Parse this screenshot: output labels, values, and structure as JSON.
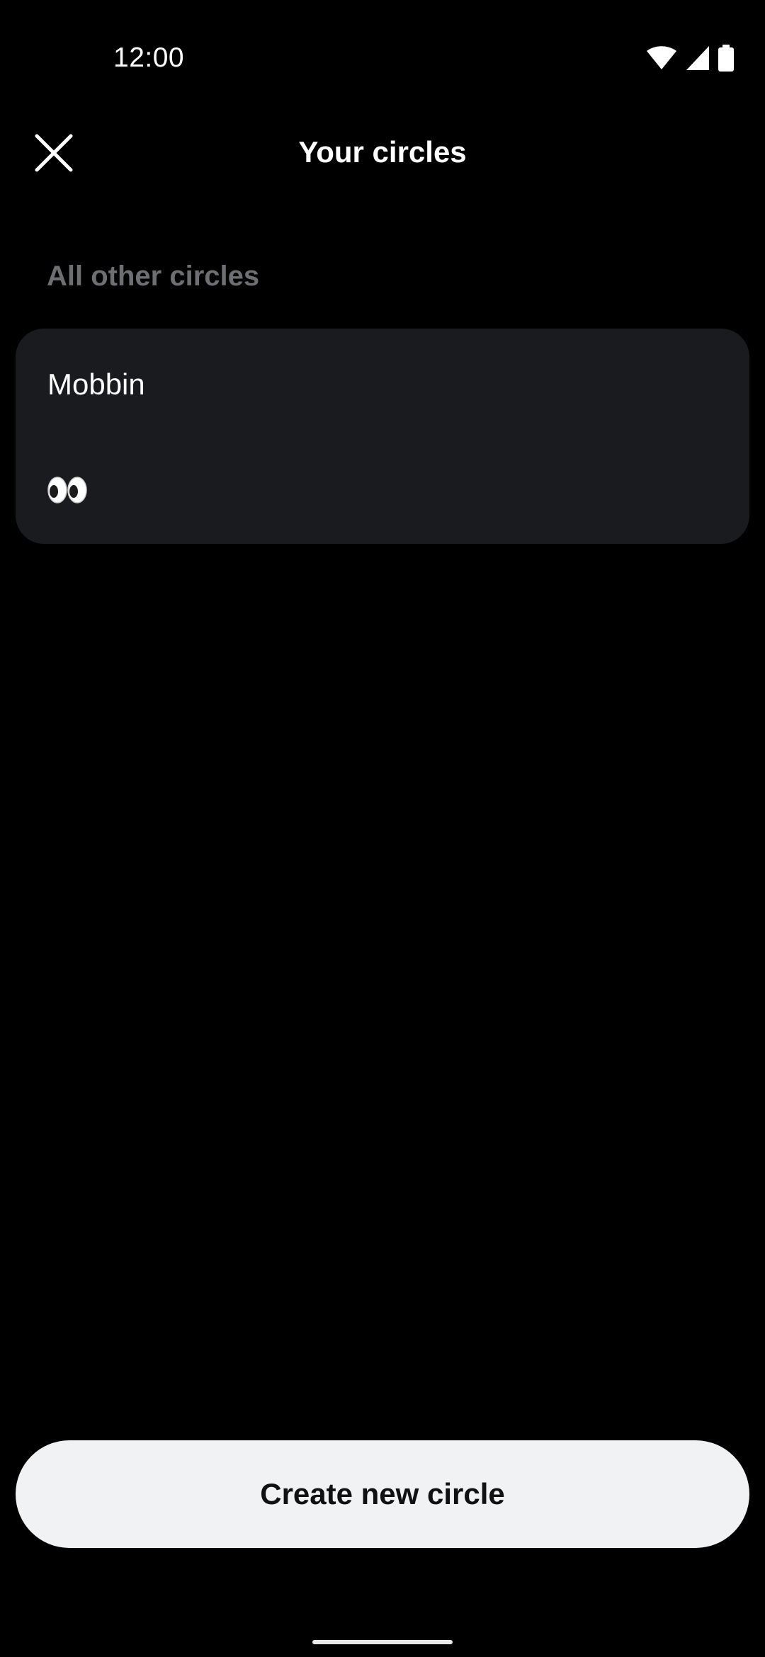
{
  "status_bar": {
    "time": "12:00",
    "icons": [
      "wifi-icon",
      "cellular-signal-icon",
      "battery-icon"
    ]
  },
  "header": {
    "title": "Your circles",
    "close_icon": "close-icon"
  },
  "section": {
    "heading": "All other circles"
  },
  "circles": [
    {
      "name": "Mobbin",
      "emoji_icon": "eyes-emoji-icon"
    }
  ],
  "actions": {
    "create_label": "Create new circle"
  },
  "colors": {
    "background": "#000000",
    "card": "#1a1b1f",
    "section_heading": "#6e6f73",
    "button": "#f1f2f4",
    "button_text": "#111111"
  }
}
